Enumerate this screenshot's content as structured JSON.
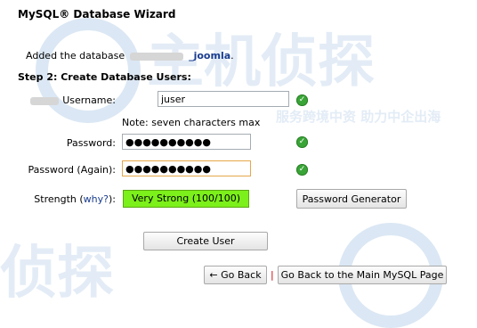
{
  "header": {
    "title": "MySQL® Database Wizard"
  },
  "status": {
    "added_prefix": "Added the database",
    "database_suffix": "_joomla",
    "added_end": "."
  },
  "step": {
    "title": "Step 2: Create Database Users:"
  },
  "form": {
    "username_label": "Username:",
    "username_value": "juser",
    "username_note": "Note: seven characters max",
    "password_label": "Password:",
    "password_value": "●●●●●●●●●●",
    "password_again_label": "Password (Again):",
    "password_again_value": "●●●●●●●●●●",
    "strength_label": "Strength (",
    "strength_link": "why?",
    "strength_label_end": "):",
    "strength_value": "Very Strong (100/100)",
    "password_generator_label": "Password Generator",
    "create_user_label": "Create User"
  },
  "nav": {
    "go_back_label": "← Go Back",
    "separator": "|",
    "main_page_label": "Go Back to the Main MySQL Page"
  },
  "icons": {
    "valid": "check-icon"
  },
  "colors": {
    "strength_bg": "#7cf01a",
    "check": "#3aa537",
    "link": "#1a3d8f"
  },
  "watermark": {
    "text_main": "主机侦探",
    "text_sub": "服务跨境中资 助力中企出海",
    "text_bottom": "侦探"
  }
}
